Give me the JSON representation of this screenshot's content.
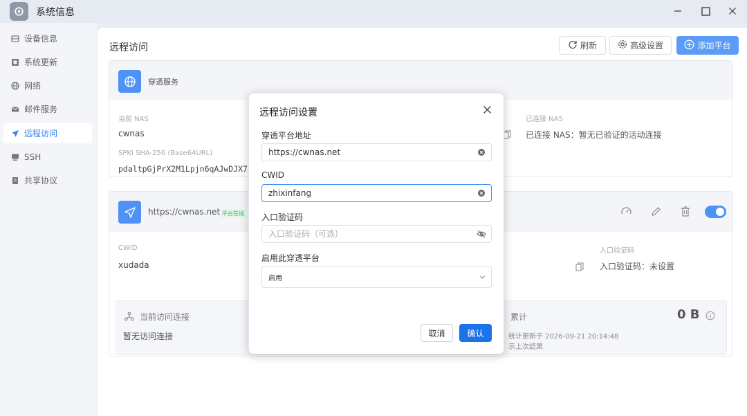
{
  "window": {
    "title": "系统信息"
  },
  "sidebar": {
    "items": [
      {
        "label": "设备信息",
        "icon": "device-icon"
      },
      {
        "label": "系统更新",
        "icon": "update-icon"
      },
      {
        "label": "网络",
        "icon": "globe-icon"
      },
      {
        "label": "邮件服务",
        "icon": "mail-icon"
      },
      {
        "label": "远程访问",
        "icon": "send-icon",
        "active": true
      },
      {
        "label": "SSH",
        "icon": "terminal-icon"
      },
      {
        "label": "共享协议",
        "icon": "share-icon"
      }
    ]
  },
  "main": {
    "title": "远程访问",
    "toolbar": {
      "refresh": "刷新",
      "advanced": "高级设置",
      "add_platform": "添加平台"
    }
  },
  "service_card": {
    "title": "穿透服务",
    "current_nas_label": "当前 NAS",
    "current_nas_value": "cwnas",
    "spki_label": "SPKI SHA-256 (Base64URL)",
    "spki_value": "pdaltpGjPrX2M1Lpjn6qAJwDJX7xh",
    "connected_nas_label": "已连接 NAS",
    "connected_nas_value": "已连接 NAS：暂无已验证的活动连接"
  },
  "platform_card": {
    "url": "https://cwnas.net",
    "status_badge": "平台在线",
    "cwid_label": "CWID",
    "cwid_value": "xudada",
    "entry_code_label": "入口验证码",
    "entry_code_value": "入口验证码：未设置",
    "stats": {
      "current_label": "当前访问连接",
      "current_value": "暂无访问连接",
      "total_label": "累计",
      "total_value": "0 B",
      "updated_line": "统计更新于 2026-09-21 20:14:48",
      "last_result_line": "示上次结果"
    }
  },
  "dialog": {
    "title": "远程访问设置",
    "platform_address_label": "穿透平台地址",
    "platform_address_value": "https://cwnas.net",
    "cwid_label": "CWID",
    "cwid_value": "zhixinfang",
    "entry_code_label": "入口验证码",
    "entry_code_placeholder": "入口验证码（可选）",
    "enable_label": "启用此穿透平台",
    "enable_value": "启用",
    "cancel": "取消",
    "confirm": "确认"
  },
  "colors": {
    "accent": "#1a73e8",
    "tile": "#4f92f5",
    "online": "#51b86c"
  }
}
